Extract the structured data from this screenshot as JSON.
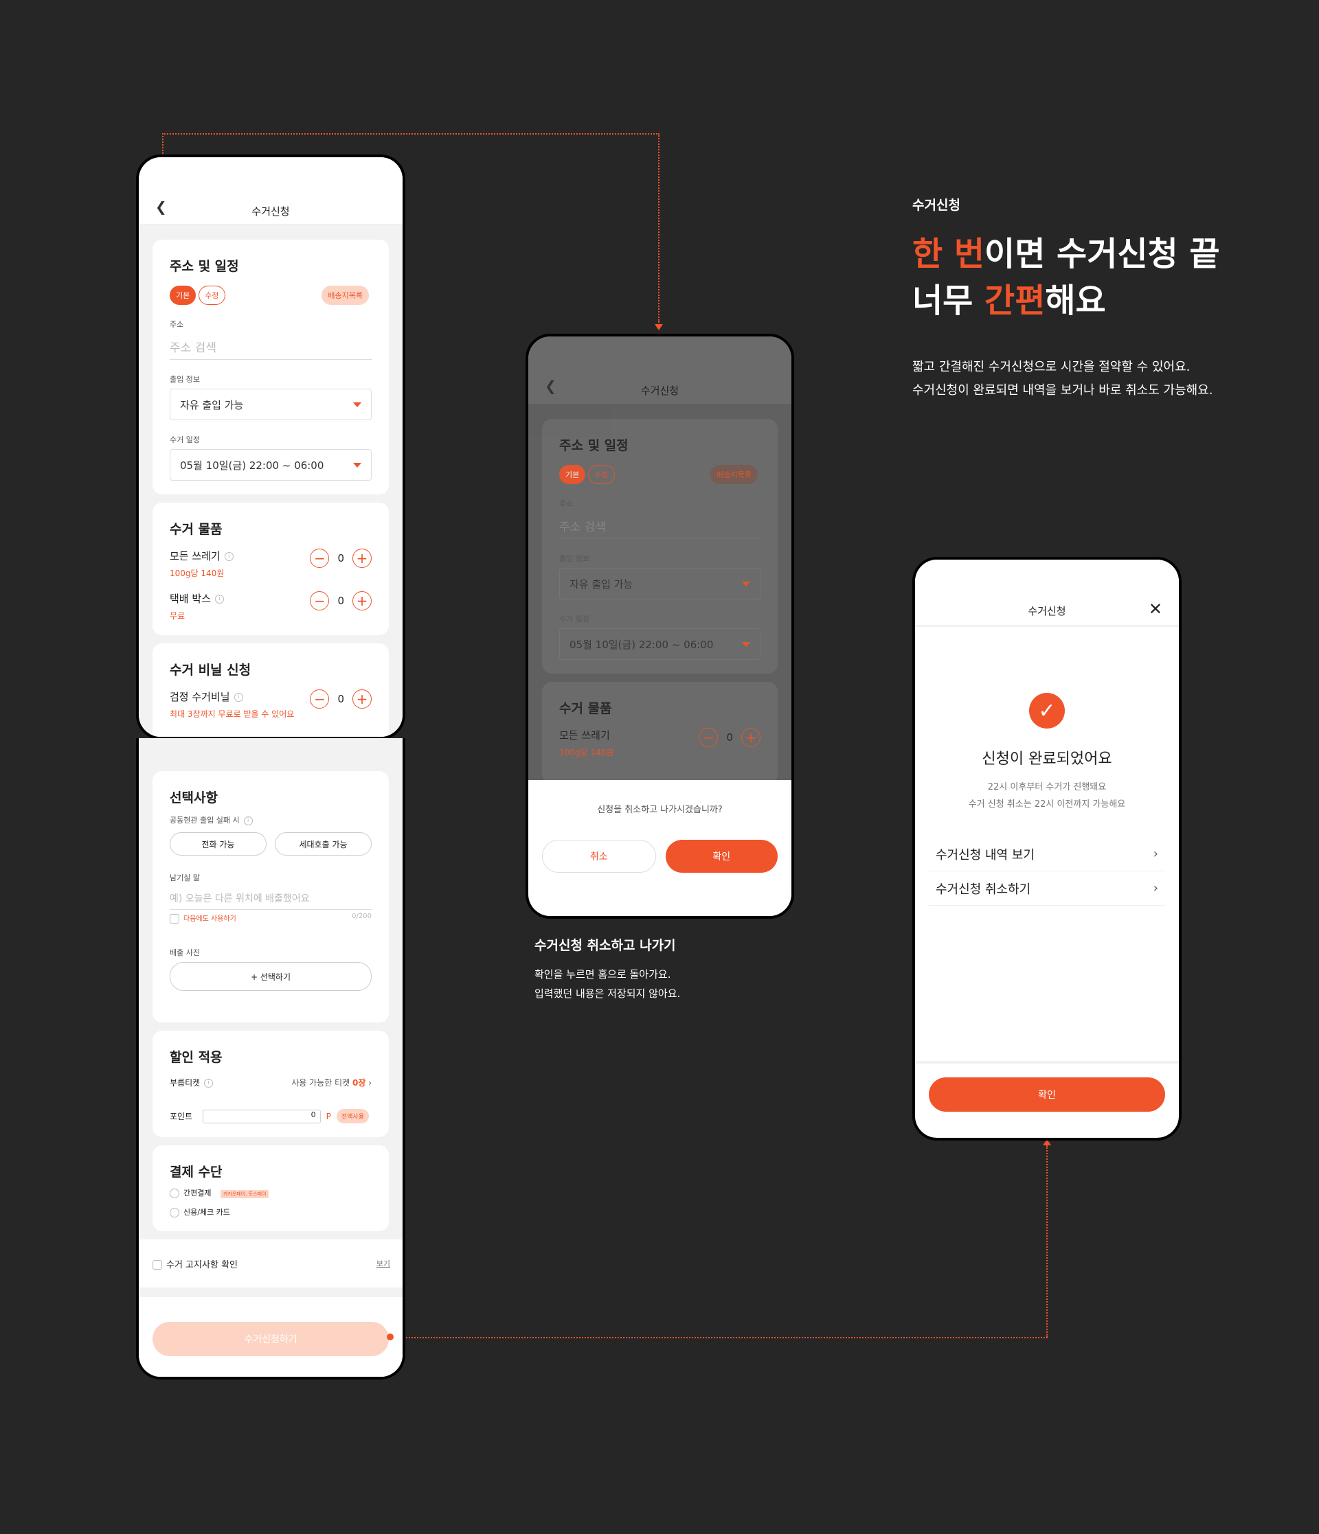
{
  "colors": {
    "accent": "#f0542a",
    "bg": "#262626",
    "accent_light": "#fdd4c4"
  },
  "section": {
    "label": "수거신청",
    "headline_line1_accent": "한 번",
    "headline_line1_rest": "이면 수거신청 끝",
    "headline_line2_start": "너무 ",
    "headline_line2_accent": "간편",
    "headline_line2_end": "해요",
    "desc1": "짧고 간결해진 수거신청으로 시간을 절약할 수 있어요.",
    "desc2": "수거신청이 완료되면 내역을 보거나 바로 취소도 가능해요."
  },
  "form": {
    "title": "수거신청",
    "addr_card_title": "주소 및 일정",
    "chip_basic": "기본",
    "chip_edit": "수정",
    "chip_addrbook": "배송지목록",
    "addr_label": "주소",
    "addr_placeholder": "주소 검색",
    "access_label": "출입 정보",
    "access_value": "자유 출입 가능",
    "schedule_label": "수거 일정",
    "schedule_value": "05월 10일(금) 22:00 ~ 06:00",
    "items_title": "수거 물품",
    "item1_name": "모든 쓰레기",
    "item1_sub": "100g당 140원",
    "item1_qty": "0",
    "item2_name": "택배 박스",
    "item2_sub": "무료",
    "item2_qty": "0",
    "bag_title": "수거 비닐 신청",
    "bag_name": "검정 수거비닐",
    "bag_qty": "0",
    "bag_sub": "최대 3장까지 무료로 받을 수 있어요",
    "opt_title": "선택사항",
    "opt_entry_label": "공동현관 출입 실패 시",
    "opt_btn1": "전화 가능",
    "opt_btn2": "세대호출 가능",
    "memo_label": "남기실 말",
    "memo_placeholder": "예) 오늘은 다른 위치에 배출했어요",
    "memo_count": "0/200",
    "memo_reuse": "다음에도 사용하기",
    "photo_label": "배출 사진",
    "photo_btn": "+ 선택하기",
    "disc_title": "할인 적용",
    "ticket_label": "부릅티켓",
    "ticket_avail": "사용 가능한 티켓",
    "ticket_count": "0장",
    "point_label": "포인트",
    "point_value": "0",
    "point_unit": "P",
    "point_all": "전액사용",
    "pay_title": "결제 수단",
    "pay1": "간편결제",
    "pay1_badge": "카카오페이, 토스페이",
    "pay2": "신용/체크 카드",
    "notice": "수거 고지사항 확인",
    "notice_link": "보기",
    "submit": "수거신청하기"
  },
  "dialog": {
    "message": "신청을 취소하고 나가시겠습니까?",
    "cancel": "취소",
    "confirm": "확인",
    "caption_title": "수거신청 취소하고 나가기",
    "caption1": "확인을 누르면 홈으로 돌아가요.",
    "caption2": "입력했던 내용은 저장되지 않아요."
  },
  "done": {
    "title": "수거신청",
    "heading": "신청이 완료되었어요",
    "sub1": "22시 이후부터 수거가 진행돼요",
    "sub2": "수거 신청 취소는 22시 이전까지 가능해요",
    "menu1": "수거신청 내역 보기",
    "menu2": "수거신청 취소하기",
    "confirm": "확인"
  }
}
